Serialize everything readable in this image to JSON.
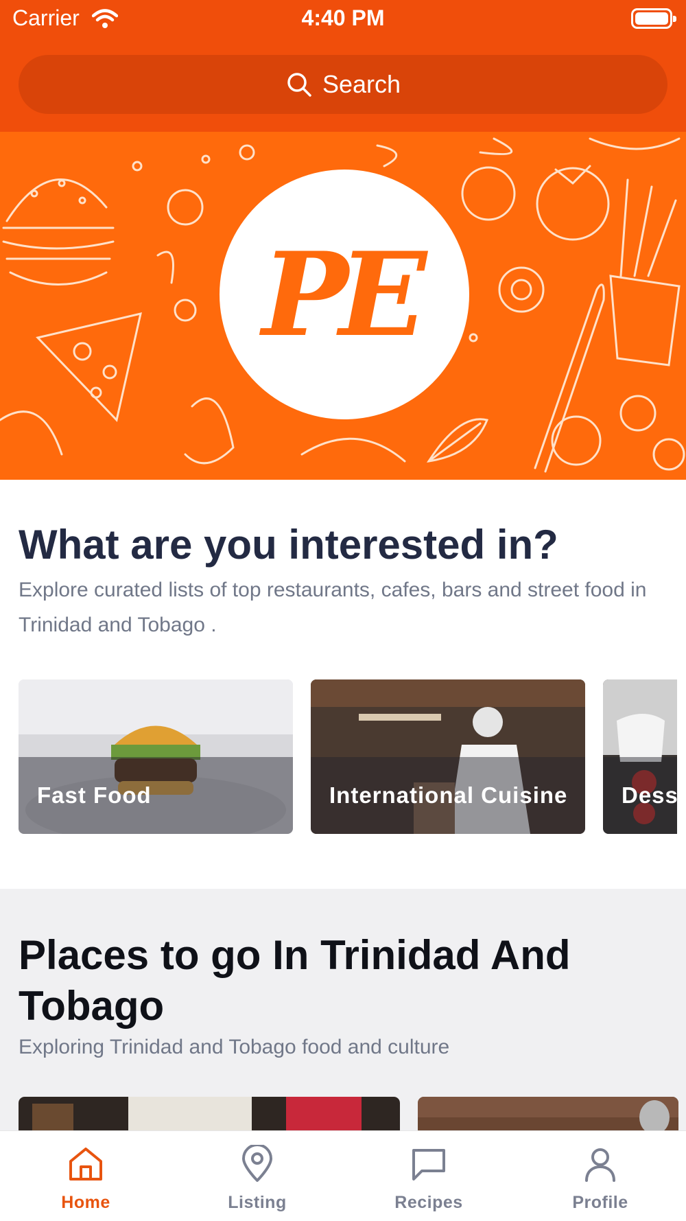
{
  "status_bar": {
    "carrier": "Carrier",
    "time": "4:40 PM"
  },
  "search": {
    "placeholder": "Search",
    "icon": "search-icon"
  },
  "hero": {
    "logo_text": "PE",
    "background_color": "#FF6A0C"
  },
  "interests": {
    "title": "What are you interested in?",
    "subtitle": "Explore curated lists of top restaurants, cafes, bars and street food in Trinidad and Tobago .",
    "categories": [
      {
        "label": "Fast Food"
      },
      {
        "label": "International Cuisine"
      },
      {
        "label": "Desserts"
      }
    ]
  },
  "places": {
    "title": "Places to go In Trinidad And Tobago",
    "subtitle": "Exploring Trinidad and Tobago food and culture"
  },
  "tabs": [
    {
      "label": "Home",
      "icon": "home-icon",
      "active": true
    },
    {
      "label": "Listing",
      "icon": "map-pin-icon",
      "active": false
    },
    {
      "label": "Recipes",
      "icon": "chat-bubble-icon",
      "active": false
    },
    {
      "label": "Profile",
      "icon": "user-icon",
      "active": false
    }
  ],
  "colors": {
    "brand": "#F04E0B",
    "accent": "#E8540F",
    "heading": "#232A43",
    "muted": "#707788"
  }
}
